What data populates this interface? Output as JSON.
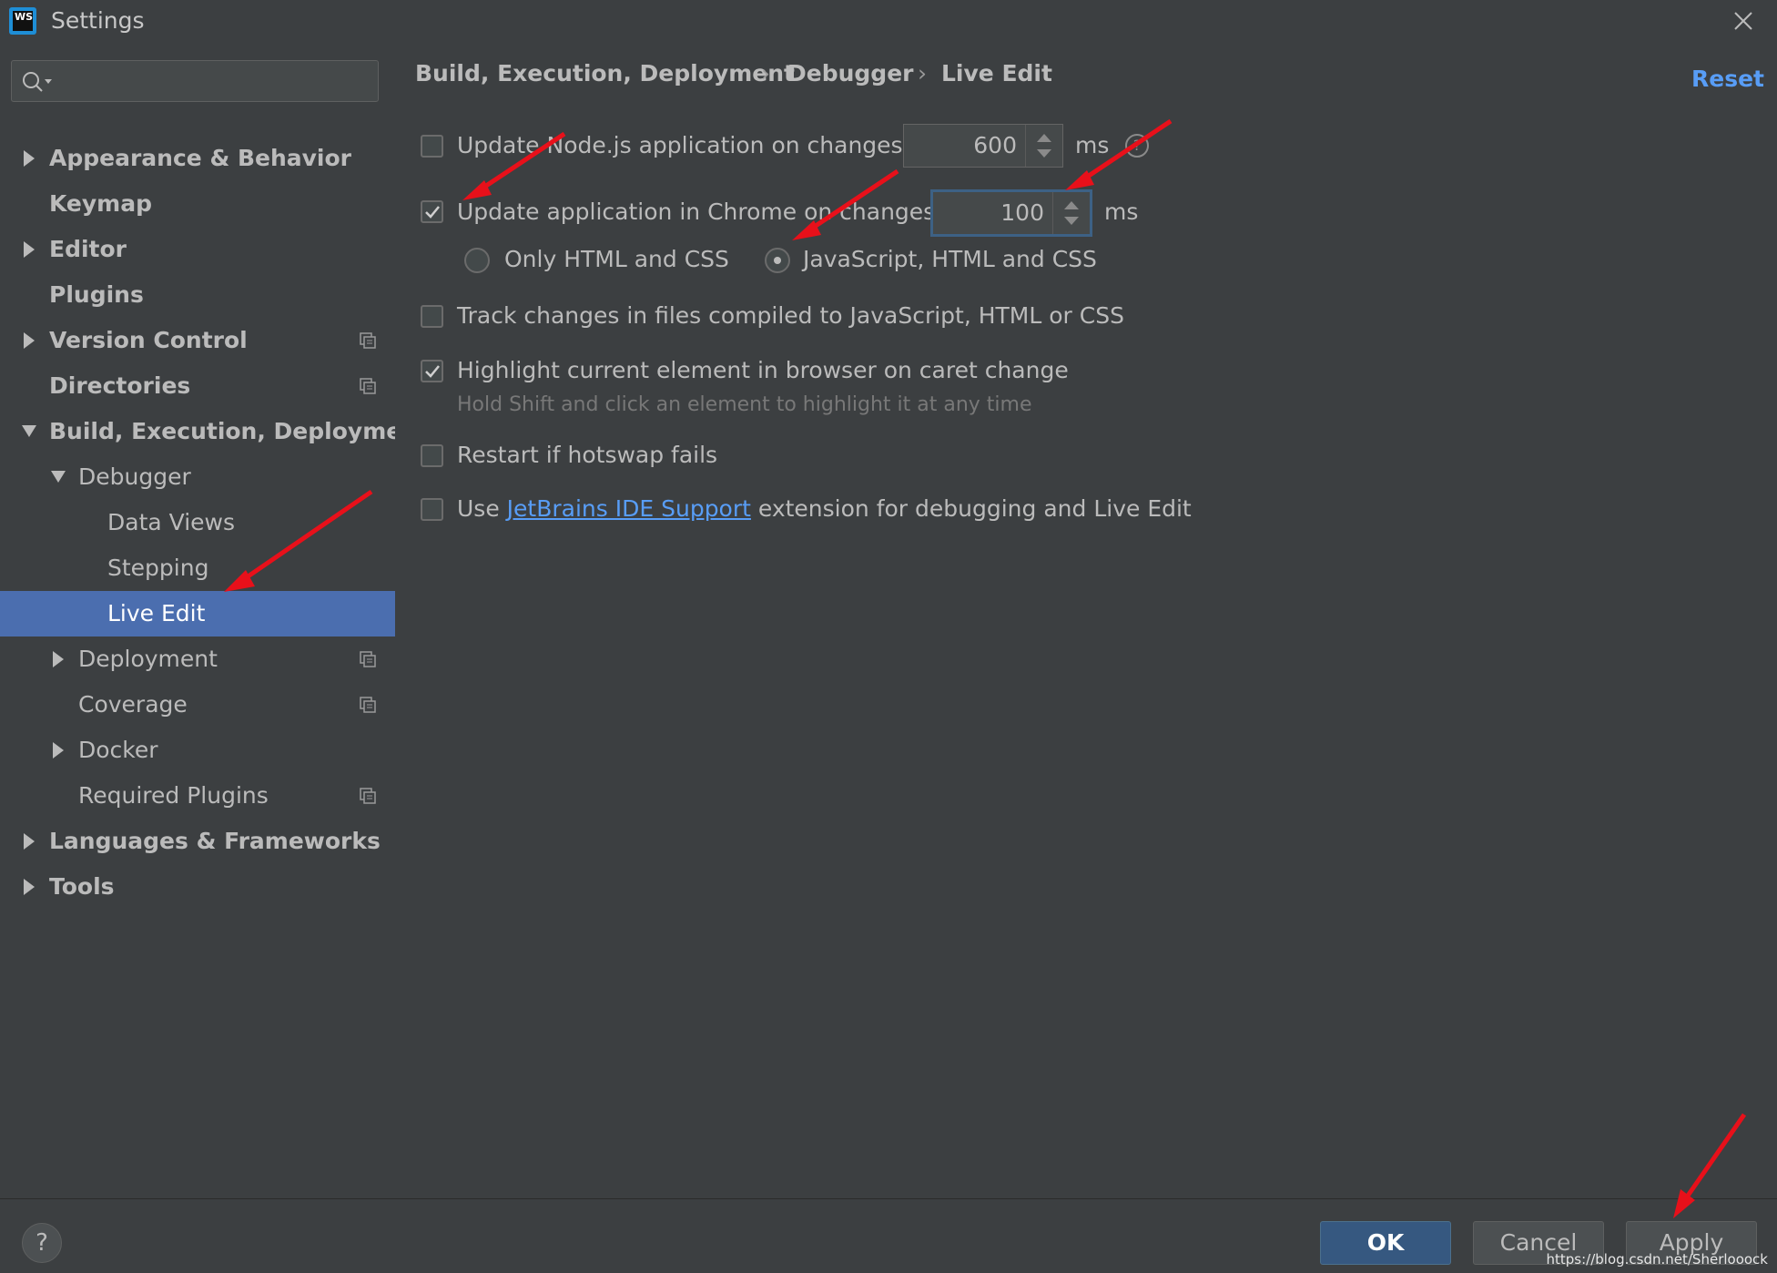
{
  "window": {
    "title": "Settings",
    "app_icon_text": "WS"
  },
  "search": {
    "placeholder": "",
    "icon": "search-icon"
  },
  "sidebar": {
    "items": [
      {
        "label": "Appearance & Behavior",
        "level": 0,
        "bold": true,
        "arrow": "right",
        "project_icon": false,
        "selected": false
      },
      {
        "label": "Keymap",
        "level": 0,
        "bold": true,
        "arrow": "none",
        "project_icon": false,
        "selected": false
      },
      {
        "label": "Editor",
        "level": 0,
        "bold": true,
        "arrow": "right",
        "project_icon": false,
        "selected": false
      },
      {
        "label": "Plugins",
        "level": 0,
        "bold": true,
        "arrow": "none",
        "project_icon": false,
        "selected": false
      },
      {
        "label": "Version Control",
        "level": 0,
        "bold": true,
        "arrow": "right",
        "project_icon": true,
        "selected": false
      },
      {
        "label": "Directories",
        "level": 0,
        "bold": true,
        "arrow": "none",
        "project_icon": true,
        "selected": false
      },
      {
        "label": "Build, Execution, Deployment",
        "level": 0,
        "bold": true,
        "arrow": "down",
        "project_icon": false,
        "selected": false
      },
      {
        "label": "Debugger",
        "level": 1,
        "bold": false,
        "arrow": "down",
        "project_icon": false,
        "selected": false
      },
      {
        "label": "Data Views",
        "level": 2,
        "bold": false,
        "arrow": "none",
        "project_icon": false,
        "selected": false
      },
      {
        "label": "Stepping",
        "level": 2,
        "bold": false,
        "arrow": "none",
        "project_icon": false,
        "selected": false
      },
      {
        "label": "Live Edit",
        "level": 2,
        "bold": false,
        "arrow": "none",
        "project_icon": false,
        "selected": true
      },
      {
        "label": "Deployment",
        "level": 1,
        "bold": false,
        "arrow": "right",
        "project_icon": true,
        "selected": false
      },
      {
        "label": "Coverage",
        "level": 1,
        "bold": false,
        "arrow": "none",
        "project_icon": true,
        "selected": false
      },
      {
        "label": "Docker",
        "level": 1,
        "bold": false,
        "arrow": "right",
        "project_icon": false,
        "selected": false
      },
      {
        "label": "Required Plugins",
        "level": 1,
        "bold": false,
        "arrow": "none",
        "project_icon": true,
        "selected": false
      },
      {
        "label": "Languages & Frameworks",
        "level": 0,
        "bold": true,
        "arrow": "right",
        "project_icon": false,
        "selected": false
      },
      {
        "label": "Tools",
        "level": 0,
        "bold": true,
        "arrow": "right",
        "project_icon": false,
        "selected": false
      }
    ]
  },
  "breadcrumb": {
    "parts": [
      "Build, Execution, Deployment",
      "Debugger",
      "Live Edit"
    ],
    "separator": "›"
  },
  "reset_label": "Reset",
  "settings": {
    "node_update": {
      "label": "Update Node.js application on changes in",
      "checked": false,
      "value": "600",
      "unit": "ms"
    },
    "chrome_update": {
      "label": "Update application in Chrome on changes in",
      "checked": true,
      "value": "100",
      "unit": "ms"
    },
    "radio_html_css": {
      "label": "Only HTML and CSS",
      "selected": false
    },
    "radio_js_html_css": {
      "label": "JavaScript, HTML and CSS",
      "selected": true
    },
    "track_changes": {
      "label": "Track changes in files compiled to JavaScript, HTML or CSS",
      "checked": false
    },
    "highlight": {
      "label": "Highlight current element in browser on caret change",
      "checked": true,
      "hint": "Hold Shift and click an element to highlight it at any time"
    },
    "restart": {
      "label": "Restart if hotswap fails",
      "checked": false
    },
    "use_ext": {
      "prefix": "Use",
      "link": "JetBrains IDE Support",
      "suffix": "extension for debugging and Live Edit",
      "checked": false
    }
  },
  "footer": {
    "help": "?",
    "ok": "OK",
    "cancel": "Cancel",
    "apply": "Apply"
  },
  "watermark": "https://blog.csdn.net/Sherlooock",
  "colors": {
    "annotation_arrow": "#e8101a",
    "selection": "#4b6eaf",
    "link": "#589df6",
    "primary_button": "#365880"
  }
}
